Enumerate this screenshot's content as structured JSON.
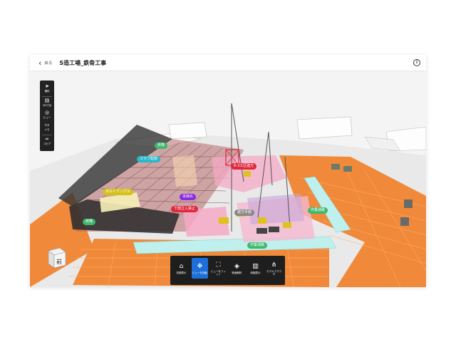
{
  "header": {
    "back_label": "戻る",
    "title": "S造工場_鉄骨工事",
    "info_icon": "info-icon"
  },
  "left_toolbar": {
    "items": [
      {
        "label": "選択",
        "icon": "cursor-icon"
      },
      {
        "label": "3D寸法",
        "icon": "ruler-icon"
      },
      {
        "label": "ビュー",
        "icon": "view-icon"
      },
      {
        "label": "メモ",
        "icon": "memo-icon"
      },
      {
        "label": "コピア",
        "icon": "link-icon"
      }
    ]
  },
  "bottom_toolbar": {
    "items": [
      {
        "label": "初期表示",
        "icon": "home-icon",
        "active": false
      },
      {
        "label": "ビューを回転",
        "icon": "rotate-icon",
        "active": true
      },
      {
        "label": "ビューをフィット",
        "icon": "fit-icon",
        "active": false
      },
      {
        "label": "断面解析",
        "icon": "section-icon",
        "active": false
      },
      {
        "label": "段階表示",
        "icon": "stage-icon",
        "active": false
      },
      {
        "label": "モデルブラウザ",
        "icon": "tree-icon",
        "active": false
      }
    ]
  },
  "labels": {
    "hoisting_top": "昇降",
    "slab_joint": "スラブ配筋",
    "ue_kiwarimashi": "6-3工区建方",
    "welding": "ボルトアングル",
    "honsetsu": "本締め",
    "no_entry_below": "下部立入禁止",
    "hoisting_left": "昇降",
    "erection_order": "建方手順",
    "work_passage_right": "作業通路",
    "work_passage_bottom": "作業通路"
  },
  "colors": {
    "label_green": "#3db86e",
    "label_cyan": "#2bb7c8",
    "label_red": "#e0283c",
    "label_yellow": "#c8b400",
    "label_purple": "#8a2be2",
    "label_gray": "#888888",
    "accent_blue": "#1e6fd9"
  },
  "nav_cube": {
    "face_label": "前"
  }
}
